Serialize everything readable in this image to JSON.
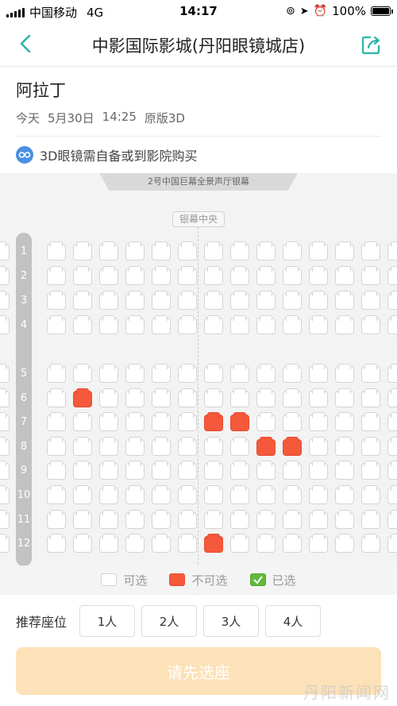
{
  "status_bar": {
    "carrier": "中国移动",
    "network": "4G",
    "time": "14:17",
    "battery": "100%"
  },
  "nav": {
    "title": "中影国际影城(丹阳眼镜城店)",
    "back_icon": "chevron-left-icon",
    "share_icon": "share-icon",
    "accent_color": "#2bb3a8"
  },
  "movie": {
    "title": "阿拉丁",
    "day": "今天",
    "date": "5月30日",
    "time": "14:25",
    "version": "原版3D"
  },
  "notice": {
    "text": "3D眼镜需自备或到影院购买",
    "icon": "glasses-icon"
  },
  "seat_map": {
    "screen_label": "2号中国巨幕全景声厅银幕",
    "center_label": "银幕中央",
    "rows": [
      "1",
      "2",
      "3",
      "4",
      "5",
      "6",
      "7",
      "8",
      "9",
      "10",
      "11",
      "12"
    ],
    "sold_seats": [
      {
        "row": "6",
        "col": 2
      },
      {
        "row": "7",
        "col": 7
      },
      {
        "row": "7",
        "col": 8
      },
      {
        "row": "8",
        "col": 9
      },
      {
        "row": "8",
        "col": 10
      },
      {
        "row": "12",
        "col": 7
      }
    ],
    "sold_color": "#f4593b"
  },
  "legend": {
    "available": "可选",
    "sold": "不可选",
    "selected": "已选",
    "selected_color": "#62b83a"
  },
  "recommend": {
    "label": "推荐座位",
    "options": [
      "1人",
      "2人",
      "3人",
      "4人"
    ]
  },
  "cta": {
    "label": "请先选座",
    "color": "#fde1b8"
  },
  "watermark": "丹阳新闻网"
}
